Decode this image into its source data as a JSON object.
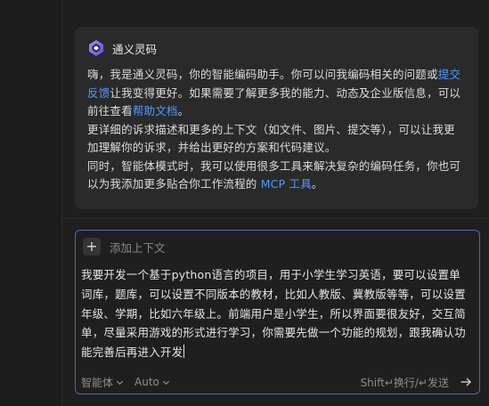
{
  "assistant": {
    "name": "通义灵码",
    "intro_a": "嗨，我是通义灵码，你的智能编码助手。你可以问我编码相关的问题或",
    "link_feedback": "提交反馈",
    "intro_b": "让我变得更好。如果需要了解更多我的能力、动态及企业版信息，可以前往查看",
    "link_help": "帮助文档",
    "intro_c": "。",
    "para2": "更详细的诉求描述和更多的上下文（如文件、图片、提交等），可以让我更加理解你的诉求，并给出更好的方案和代码建议。",
    "para3_a": "同时，智能体模式时，我可以使用很多工具来解决复杂的编码任务，你也可以为我添加更多贴合你工作流程的 ",
    "link_mcp": "MCP 工具",
    "para3_b": "。"
  },
  "composer": {
    "add_context_label": "添加上下文",
    "text": "我要开发一个基于python语言的项目，用于小学生学习英语，要可以设置单词库，题库，可以设置不同版本的教材，比如人教版、冀教版等等，可以设置年级、学期，比如六年级上。前端用户是小学生，所以界面要很友好，交互简单，尽量采用游戏的形式进行学习，你需要先做一个功能的规划，跟我确认功能完善后再进入开发",
    "mode_select": "智能体",
    "model_select": "Auto",
    "shortcut_hint": "Shift↵换行/↵发送"
  },
  "colors": {
    "accent_link": "#4d9cff",
    "composer_border": "#3f6fb8",
    "card_bg": "#2a2a2a",
    "page_bg": "#1f1f1f"
  },
  "icons": {
    "brand": "tongyi-lingma-logo-icon",
    "add": "plus-icon",
    "dropdown": "chevron-down-icon",
    "send": "arrow-right-icon"
  }
}
